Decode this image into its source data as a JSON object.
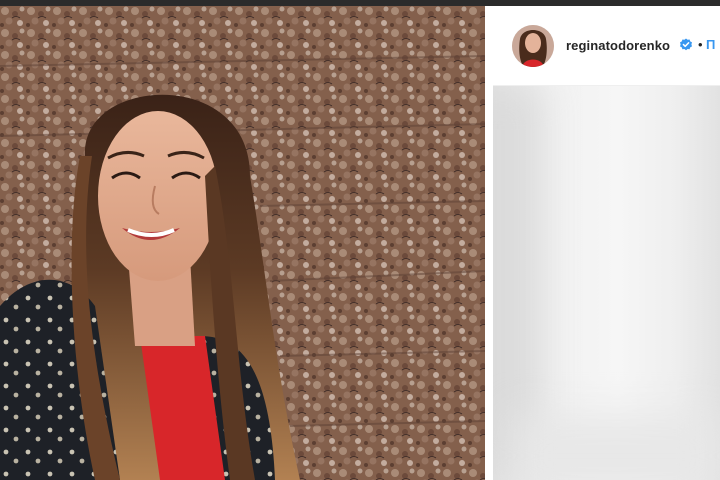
{
  "post": {
    "username": "reginatodorenko",
    "separator": "•",
    "follow_label": "П"
  },
  "icons": {
    "verified": "verified-badge-icon",
    "avatar": "profile-avatar"
  },
  "colors": {
    "link_blue": "#3897f0",
    "verified_blue": "#3897f0",
    "text_dark": "#262626",
    "divider_white": "#ffffff"
  }
}
